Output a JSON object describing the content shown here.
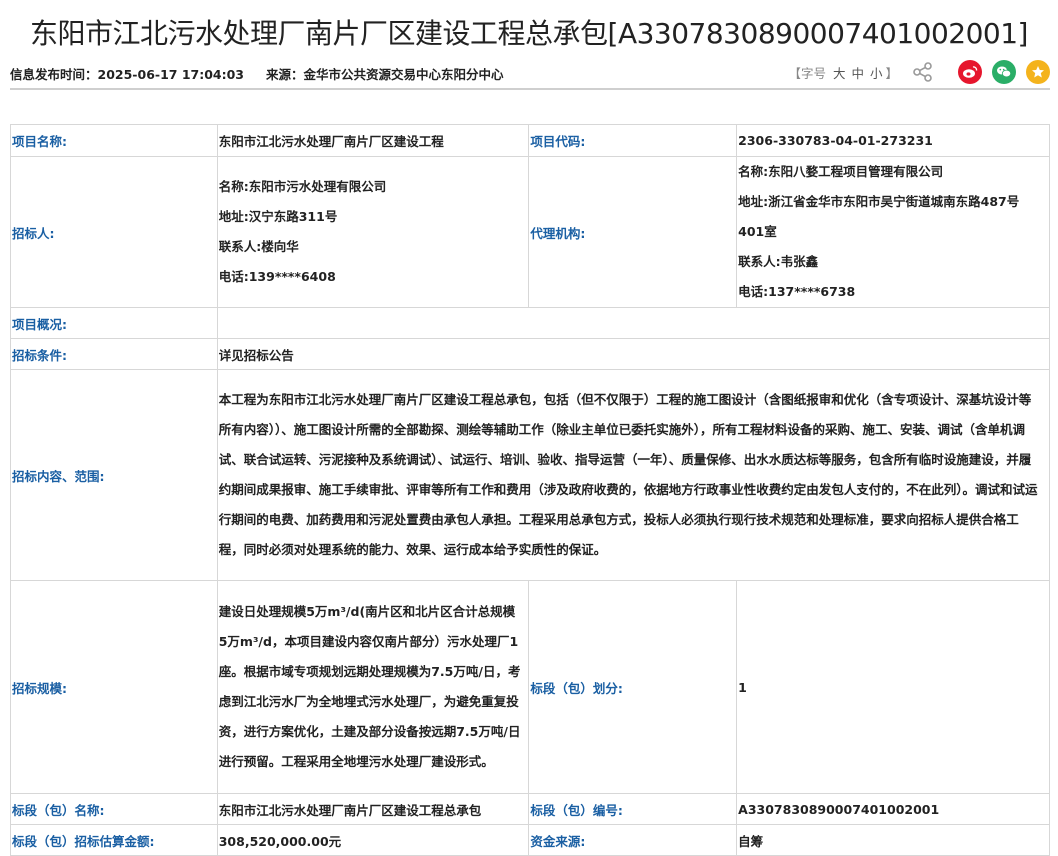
{
  "title": "东阳市江北污水处理厂南片厂区建设工程总承包[A3307830890007401002001]",
  "meta": {
    "publish_label": "信息发布时间：",
    "publish_time": "2025-06-17 17:04:03",
    "source_label": "来源：",
    "source_value": "金华市公共资源交易中心东阳分中心"
  },
  "font_size": {
    "open": "【字号",
    "large": "大",
    "medium": "中",
    "small": "小",
    "close": "】"
  },
  "share": {
    "icons": [
      "share-icon",
      "weibo-icon",
      "wechat-icon",
      "favorite-icon"
    ],
    "colors": {
      "weibo": "#e6162d",
      "wechat": "#2aae67",
      "favorite": "#f4b31c"
    }
  },
  "colors": {
    "label": "#1a5fa3",
    "border": "#d7d7d7"
  },
  "table": {
    "project_name_label": "项目名称:",
    "project_name": "东阳市江北污水处理厂南片厂区建设工程",
    "project_code_label": "项目代码:",
    "project_code": "2306-330783-04-01-273231",
    "tenderer_label": "招标人:",
    "tenderer": {
      "name": "名称:东阳市污水处理有限公司",
      "address": "地址:汉宁东路311号",
      "contact": "联系人:楼向华",
      "phone": "电话:139****6408"
    },
    "agency_label": "代理机构:",
    "agency": {
      "name": "名称:东阳八婺工程项目管理有限公司",
      "address": "地址:浙江省金华市东阳市吴宁街道城南东路487号401室",
      "contact": "联系人:韦张鑫",
      "phone": "电话:137****6738"
    },
    "overview_label": "项目概况:",
    "overview": "",
    "conditions_label": "招标条件:",
    "conditions": "详见招标公告",
    "scope_label": "招标内容、范围:",
    "scope": "本工程为东阳市江北污水处理厂南片厂区建设工程总承包，包括（但不仅限于）工程的施工图设计（含图纸报审和优化（含专项设计、深基坑设计等所有内容））、施工图设计所需的全部勘探、测绘等辅助工作（除业主单位已委托实施外），所有工程材料设备的采购、施工、安装、调试（含单机调试、联合试运转、污泥接种及系统调试）、试运行、培训、验收、指导运营（一年）、质量保修、出水水质达标等服务，包含所有临时设施建设，并履约期间成果报审、施工手续审批、评审等所有工作和费用（涉及政府收费的，依据地方行政事业性收费约定由发包人支付的，不在此列）。调试和试运行期间的电费、加药费用和污泥处置费由承包人承担。工程采用总承包方式，投标人必须执行现行技术规范和处理标准，要求向招标人提供合格工程，同时必须对处理系统的能力、效果、运行成本给予实质性的保证。",
    "scale_label": "招标规模:",
    "scale": "建设日处理规模5万m³/d(南片区和北片区合计总规模5万m³/d，本项目建设内容仅南片部分）污水处理厂1座。根据市域专项规划远期处理规模为7.5万吨/日，考虑到江北污水厂为全地埋式污水处理厂，为避免重复投资，进行方案优化，土建及部分设备按远期7.5万吨/日进行预留。工程采用全地埋污水处理厂建设形式。",
    "section_division_label": "标段（包）划分:",
    "section_division": "1",
    "section_name_label": "标段（包）名称:",
    "section_name": "东阳市江北污水处理厂南片厂区建设工程总承包",
    "section_no_label": "标段（包）编号:",
    "section_no": "A3307830890007401002001",
    "estimate_label": "标段（包）招标估算金额:",
    "estimate": "308,520,000.00元",
    "fund_label": "资金来源:",
    "fund": "自筹"
  }
}
